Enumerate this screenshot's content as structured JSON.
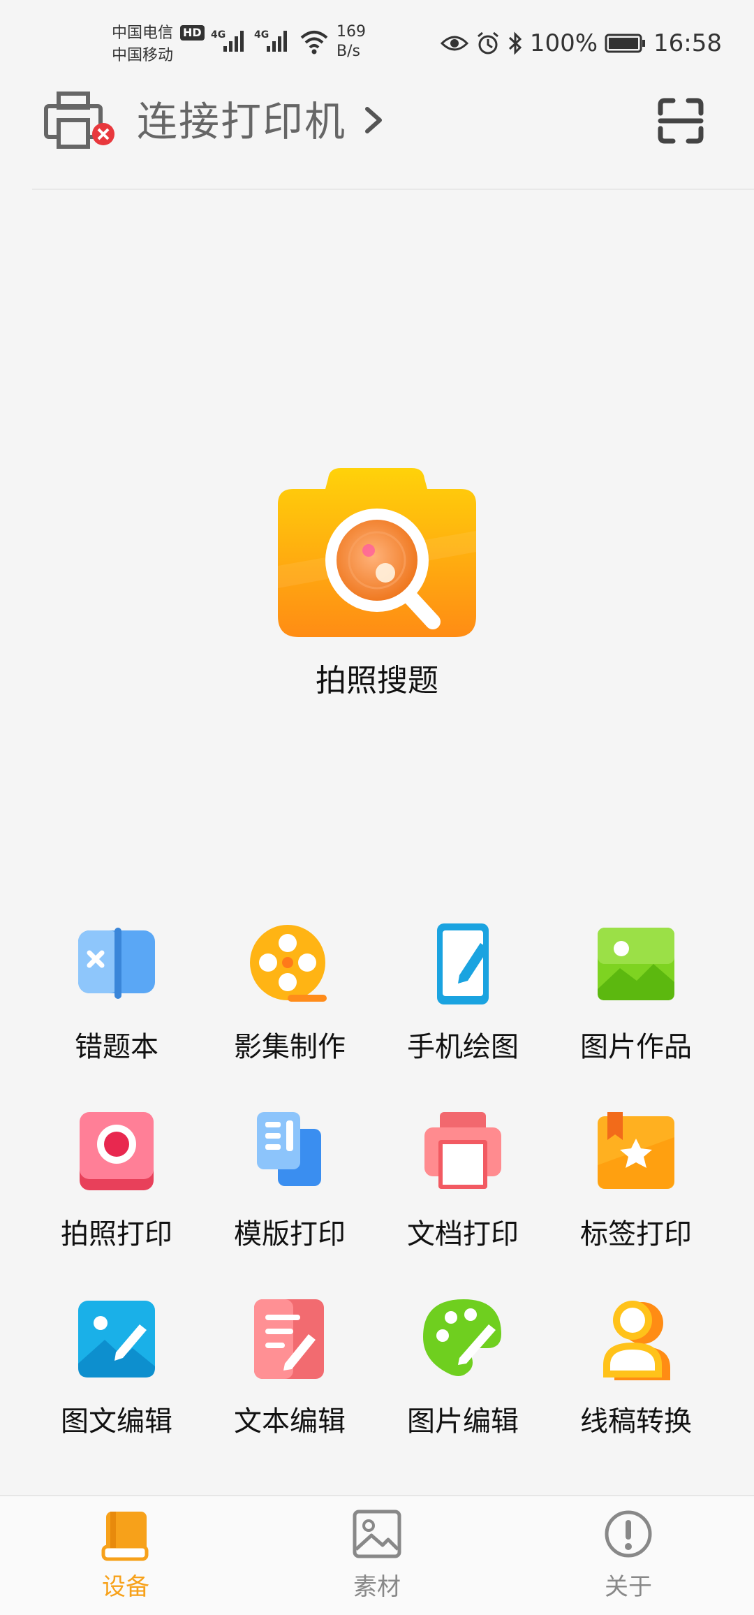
{
  "status_bar": {
    "carrier_1": "中国电信",
    "carrier_2": "中国移动",
    "hd_badge": "HD",
    "network_1": "4G",
    "network_2": "4G",
    "speed_value": "169",
    "speed_unit": "B/s",
    "battery_percent": "100%",
    "time": "16:58"
  },
  "topbar": {
    "connect_label": "连接打印机",
    "printer_status_icon": "printer-disconnected-icon",
    "scan_icon": "scan-icon"
  },
  "hero": {
    "label": "拍照搜题",
    "icon": "camera-search-icon"
  },
  "grid": [
    {
      "label": "错题本",
      "icon": "wrong-answers-book-icon"
    },
    {
      "label": "影集制作",
      "icon": "film-reel-icon"
    },
    {
      "label": "手机绘图",
      "icon": "phone-draw-icon"
    },
    {
      "label": "图片作品",
      "icon": "picture-gallery-icon"
    },
    {
      "label": "拍照打印",
      "icon": "photo-print-icon"
    },
    {
      "label": "模版打印",
      "icon": "template-print-icon"
    },
    {
      "label": "文档打印",
      "icon": "document-print-icon"
    },
    {
      "label": "标签打印",
      "icon": "label-print-icon"
    },
    {
      "label": "图文编辑",
      "icon": "image-text-edit-icon"
    },
    {
      "label": "文本编辑",
      "icon": "text-edit-icon"
    },
    {
      "label": "图片编辑",
      "icon": "palette-edit-icon"
    },
    {
      "label": "线稿转换",
      "icon": "lineart-convert-icon"
    }
  ],
  "bottom_nav": [
    {
      "label": "设备",
      "icon": "device-book-icon",
      "active": true
    },
    {
      "label": "素材",
      "icon": "material-image-icon",
      "active": false
    },
    {
      "label": "关于",
      "icon": "info-icon",
      "active": false
    }
  ],
  "colors": {
    "accent": "#f7a11a",
    "nav_inactive": "#888888",
    "text_primary": "#111111"
  }
}
